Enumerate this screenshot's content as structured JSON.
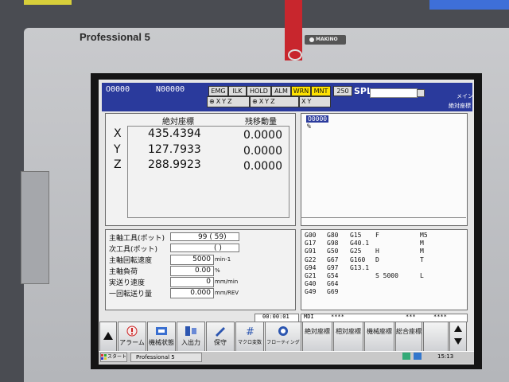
{
  "bezel": {
    "brand": "Professional 5",
    "logo": "MAKINO"
  },
  "header": {
    "program_o": "O0000",
    "program_n": "N00000",
    "status": [
      "EMG",
      "ILK",
      "HOLD",
      "ALM",
      "WRN",
      "MNT",
      "250"
    ],
    "mode": "SPL",
    "right_top": "メイン",
    "right_bottom": "絶対座標",
    "axis_row1": "⊕XYZ",
    "axis_row2": "⊕XYZ",
    "axis_row3": "XY"
  },
  "position": {
    "col1": "絶対座標",
    "col2": "残移動量",
    "rows": [
      {
        "axis": "X",
        "abs": "435.4394",
        "rem": "0.0000"
      },
      {
        "axis": "Y",
        "abs": "127.7933",
        "rem": "0.0000"
      },
      {
        "axis": "Z",
        "abs": "288.9923",
        "rem": "0.0000"
      }
    ]
  },
  "program": {
    "line1": "O0000",
    "line2": "%"
  },
  "spindle": {
    "rows": [
      {
        "label": "主軸工具(ポット)",
        "value": "99  ( 59)",
        "unit": ""
      },
      {
        "label": "次工具(ポット)",
        "value": "(  )",
        "unit": ""
      },
      {
        "label": "主軸回転速度",
        "value": "5000",
        "unit": "min-1"
      },
      {
        "label": "主軸負荷",
        "value": "0.00",
        "unit": "%"
      },
      {
        "label": "実送り速度",
        "value": "0",
        "unit": "mm/min"
      },
      {
        "label": "一回転送り量",
        "value": "0.000",
        "unit": "mm/REV"
      }
    ]
  },
  "gcodes": {
    "rows": [
      [
        "G00",
        "G80",
        "G15",
        "F",
        "",
        "M5"
      ],
      [
        "G17",
        "G98",
        "G40.1",
        "",
        "",
        "M"
      ],
      [
        "G91",
        "G50",
        "G25",
        "H",
        "",
        "M"
      ],
      [
        "G22",
        "G67",
        "G160",
        "D",
        "",
        "T"
      ],
      [
        "G94",
        "G97",
        "G13.1",
        "",
        "",
        ""
      ],
      [
        "G21",
        "G54",
        "",
        "S 5000",
        "",
        "L"
      ],
      [
        "G40",
        "G64",
        "",
        "",
        "",
        ""
      ],
      [
        "G49",
        "G69",
        "",
        "",
        "",
        ""
      ]
    ]
  },
  "statusbar": {
    "time": "00:00:01",
    "mode": "MDI",
    "f1": "****",
    "f2": "***",
    "f3": "****"
  },
  "softkeys": {
    "left": [
      {
        "label": "アラーム"
      },
      {
        "label": "機械状態"
      },
      {
        "label": "入出力"
      },
      {
        "label": "保守"
      },
      {
        "label": "マクロ変数"
      },
      {
        "label": "フローティング"
      }
    ],
    "right": [
      {
        "label": "絶対座標"
      },
      {
        "label": "相対座標"
      },
      {
        "label": "機械座標"
      },
      {
        "label": "総合座標"
      }
    ]
  },
  "taskbar": {
    "start": "スタート",
    "app": "Professional 5",
    "clock": "15:13"
  }
}
